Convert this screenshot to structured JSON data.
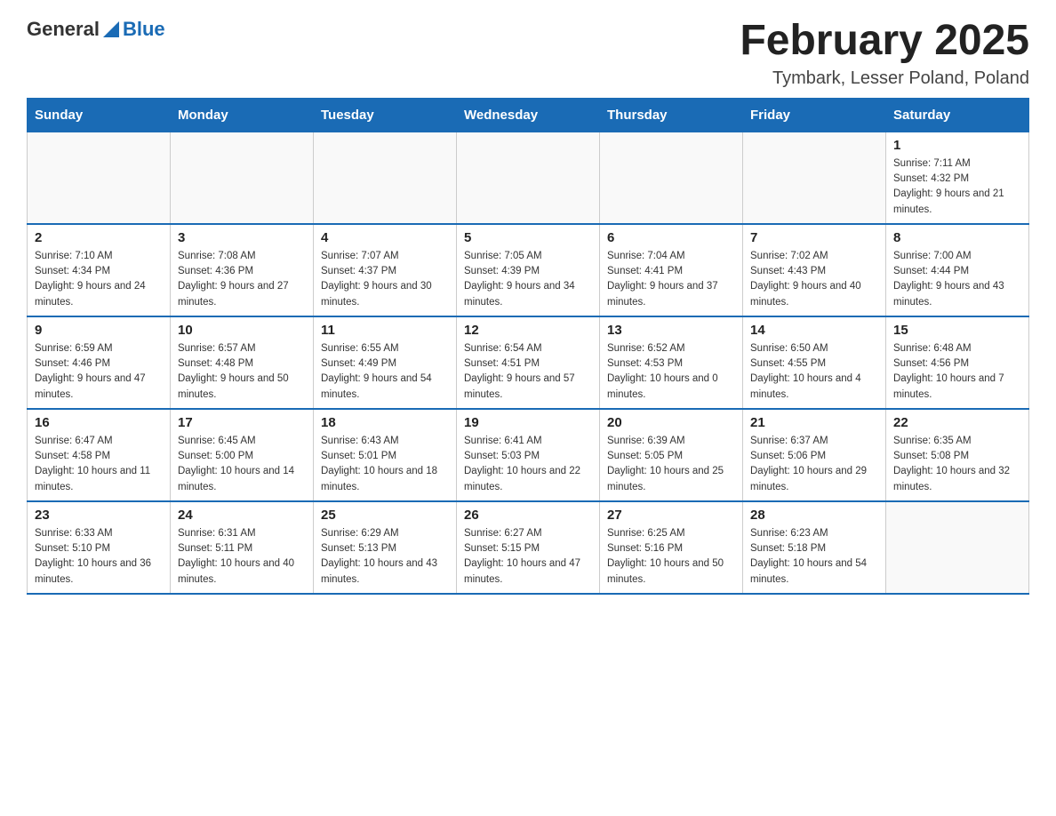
{
  "header": {
    "logo_general": "General",
    "logo_blue": "Blue",
    "month_title": "February 2025",
    "location": "Tymbark, Lesser Poland, Poland"
  },
  "days_of_week": [
    "Sunday",
    "Monday",
    "Tuesday",
    "Wednesday",
    "Thursday",
    "Friday",
    "Saturday"
  ],
  "weeks": [
    [
      {
        "day": "",
        "info": ""
      },
      {
        "day": "",
        "info": ""
      },
      {
        "day": "",
        "info": ""
      },
      {
        "day": "",
        "info": ""
      },
      {
        "day": "",
        "info": ""
      },
      {
        "day": "",
        "info": ""
      },
      {
        "day": "1",
        "info": "Sunrise: 7:11 AM\nSunset: 4:32 PM\nDaylight: 9 hours and 21 minutes."
      }
    ],
    [
      {
        "day": "2",
        "info": "Sunrise: 7:10 AM\nSunset: 4:34 PM\nDaylight: 9 hours and 24 minutes."
      },
      {
        "day": "3",
        "info": "Sunrise: 7:08 AM\nSunset: 4:36 PM\nDaylight: 9 hours and 27 minutes."
      },
      {
        "day": "4",
        "info": "Sunrise: 7:07 AM\nSunset: 4:37 PM\nDaylight: 9 hours and 30 minutes."
      },
      {
        "day": "5",
        "info": "Sunrise: 7:05 AM\nSunset: 4:39 PM\nDaylight: 9 hours and 34 minutes."
      },
      {
        "day": "6",
        "info": "Sunrise: 7:04 AM\nSunset: 4:41 PM\nDaylight: 9 hours and 37 minutes."
      },
      {
        "day": "7",
        "info": "Sunrise: 7:02 AM\nSunset: 4:43 PM\nDaylight: 9 hours and 40 minutes."
      },
      {
        "day": "8",
        "info": "Sunrise: 7:00 AM\nSunset: 4:44 PM\nDaylight: 9 hours and 43 minutes."
      }
    ],
    [
      {
        "day": "9",
        "info": "Sunrise: 6:59 AM\nSunset: 4:46 PM\nDaylight: 9 hours and 47 minutes."
      },
      {
        "day": "10",
        "info": "Sunrise: 6:57 AM\nSunset: 4:48 PM\nDaylight: 9 hours and 50 minutes."
      },
      {
        "day": "11",
        "info": "Sunrise: 6:55 AM\nSunset: 4:49 PM\nDaylight: 9 hours and 54 minutes."
      },
      {
        "day": "12",
        "info": "Sunrise: 6:54 AM\nSunset: 4:51 PM\nDaylight: 9 hours and 57 minutes."
      },
      {
        "day": "13",
        "info": "Sunrise: 6:52 AM\nSunset: 4:53 PM\nDaylight: 10 hours and 0 minutes."
      },
      {
        "day": "14",
        "info": "Sunrise: 6:50 AM\nSunset: 4:55 PM\nDaylight: 10 hours and 4 minutes."
      },
      {
        "day": "15",
        "info": "Sunrise: 6:48 AM\nSunset: 4:56 PM\nDaylight: 10 hours and 7 minutes."
      }
    ],
    [
      {
        "day": "16",
        "info": "Sunrise: 6:47 AM\nSunset: 4:58 PM\nDaylight: 10 hours and 11 minutes."
      },
      {
        "day": "17",
        "info": "Sunrise: 6:45 AM\nSunset: 5:00 PM\nDaylight: 10 hours and 14 minutes."
      },
      {
        "day": "18",
        "info": "Sunrise: 6:43 AM\nSunset: 5:01 PM\nDaylight: 10 hours and 18 minutes."
      },
      {
        "day": "19",
        "info": "Sunrise: 6:41 AM\nSunset: 5:03 PM\nDaylight: 10 hours and 22 minutes."
      },
      {
        "day": "20",
        "info": "Sunrise: 6:39 AM\nSunset: 5:05 PM\nDaylight: 10 hours and 25 minutes."
      },
      {
        "day": "21",
        "info": "Sunrise: 6:37 AM\nSunset: 5:06 PM\nDaylight: 10 hours and 29 minutes."
      },
      {
        "day": "22",
        "info": "Sunrise: 6:35 AM\nSunset: 5:08 PM\nDaylight: 10 hours and 32 minutes."
      }
    ],
    [
      {
        "day": "23",
        "info": "Sunrise: 6:33 AM\nSunset: 5:10 PM\nDaylight: 10 hours and 36 minutes."
      },
      {
        "day": "24",
        "info": "Sunrise: 6:31 AM\nSunset: 5:11 PM\nDaylight: 10 hours and 40 minutes."
      },
      {
        "day": "25",
        "info": "Sunrise: 6:29 AM\nSunset: 5:13 PM\nDaylight: 10 hours and 43 minutes."
      },
      {
        "day": "26",
        "info": "Sunrise: 6:27 AM\nSunset: 5:15 PM\nDaylight: 10 hours and 47 minutes."
      },
      {
        "day": "27",
        "info": "Sunrise: 6:25 AM\nSunset: 5:16 PM\nDaylight: 10 hours and 50 minutes."
      },
      {
        "day": "28",
        "info": "Sunrise: 6:23 AM\nSunset: 5:18 PM\nDaylight: 10 hours and 54 minutes."
      },
      {
        "day": "",
        "info": ""
      }
    ]
  ]
}
